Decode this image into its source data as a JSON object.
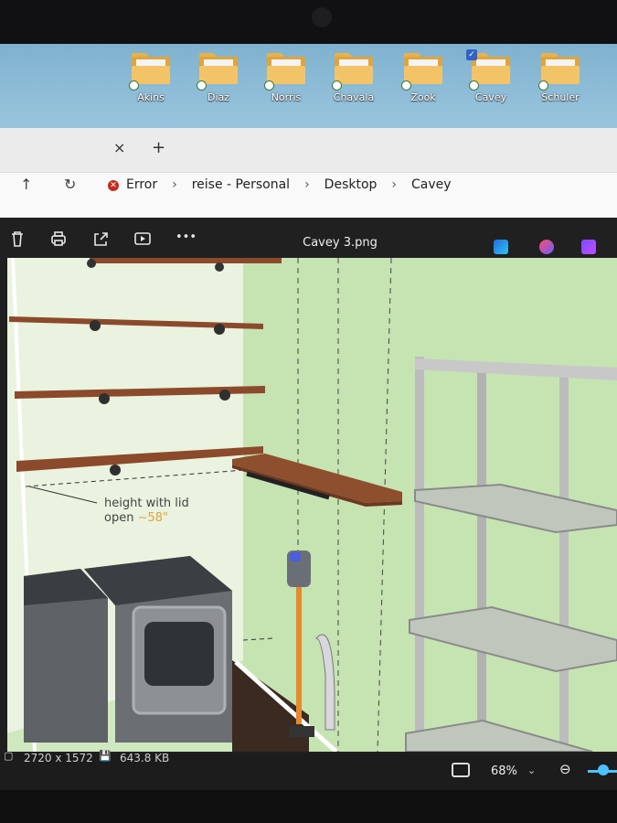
{
  "desktop": {
    "folders": [
      {
        "label": "Akins",
        "selected": false
      },
      {
        "label": "Diaz",
        "selected": false
      },
      {
        "label": "Norris",
        "selected": false
      },
      {
        "label": "Chavala",
        "selected": false
      },
      {
        "label": "Zook",
        "selected": false
      },
      {
        "label": "Cavey",
        "selected": true
      },
      {
        "label": "Schuler",
        "selected": false
      }
    ]
  },
  "explorer": {
    "tab_close_glyph": "×",
    "tab_new_glyph": "+",
    "breadcrumb": [
      "Error",
      "reise - Personal",
      "Desktop",
      "Cavey"
    ]
  },
  "viewer": {
    "title": "Cavey 3.png",
    "toolbar_more": "•••",
    "annotation": {
      "line1": "height with lid",
      "line2_prefix": "open",
      "line2_value": "~58\""
    },
    "status": {
      "dimensions": "2720 x 1572",
      "file_size": "643.8 KB",
      "zoom": "68%"
    }
  },
  "colors": {
    "wall": "#cde8bd",
    "shelf_wood": "#8b4a2b",
    "rack_metal": "#bcbcbc"
  }
}
